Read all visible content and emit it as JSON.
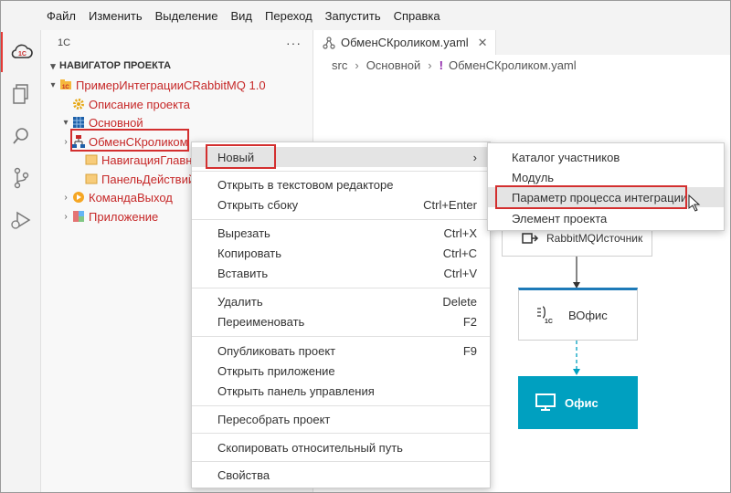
{
  "menubar": [
    "Файл",
    "Изменить",
    "Выделение",
    "Вид",
    "Переход",
    "Запустить",
    "Справка"
  ],
  "activity": [
    {
      "icon": "1c-cloud-icon",
      "active": true
    },
    {
      "icon": "files-icon",
      "active": false
    },
    {
      "icon": "search-icon",
      "active": false
    },
    {
      "icon": "source-control-icon",
      "active": false
    },
    {
      "icon": "run-debug-icon",
      "active": false
    }
  ],
  "sidebar": {
    "title": "1С",
    "more": "···",
    "section": "НАВИГАТОР ПРОЕКТА",
    "tree": [
      {
        "label": "ПримерИнтеграцииCRabbitMQ 1.0",
        "chevron": "▾",
        "icon": "project-icon",
        "depth": 0
      },
      {
        "label": "Описание проекта",
        "chevron": "",
        "icon": "gear-icon",
        "depth": 1
      },
      {
        "label": "Основной",
        "chevron": "▾",
        "icon": "grid-icon",
        "depth": 1
      },
      {
        "label": "ОбменСКроликом",
        "chevron": "›",
        "icon": "integration-icon",
        "depth": 2
      },
      {
        "label": "НавигацияГлавная",
        "chevron": "",
        "icon": "doc-icon",
        "depth": 2
      },
      {
        "label": "ПанельДействий",
        "chevron": "",
        "icon": "doc-icon",
        "depth": 2
      },
      {
        "label": "КомандаВыход",
        "chevron": "›",
        "icon": "play-icon",
        "depth": 2
      },
      {
        "label": "Приложение",
        "chevron": "›",
        "icon": "app-icon",
        "depth": 2
      }
    ]
  },
  "editor": {
    "tab": {
      "label": "ОбменСКроликом.yaml",
      "close": "✕"
    },
    "breadcrumbs": [
      "src",
      "Основной",
      "ОбменСКроликом.yaml"
    ],
    "breadcrumb_sep": "›",
    "breadcrumb_mark": "!"
  },
  "diagram": {
    "node1": "RabbitMQИсточник",
    "node2": "ВОфис",
    "node3": "Офис"
  },
  "context_menu": {
    "items": [
      {
        "label": "Новый",
        "shortcut": "›"
      },
      {
        "label": "Открыть в текстовом редакторе",
        "shortcut": ""
      },
      {
        "label": "Открыть сбоку",
        "shortcut": "Ctrl+Enter"
      },
      {
        "label": "Вырезать",
        "shortcut": "Ctrl+X"
      },
      {
        "label": "Копировать",
        "shortcut": "Ctrl+C"
      },
      {
        "label": "Вставить",
        "shortcut": "Ctrl+V"
      },
      {
        "label": "Удалить",
        "shortcut": "Delete"
      },
      {
        "label": "Переименовать",
        "shortcut": "F2"
      },
      {
        "label": "Опубликовать проект",
        "shortcut": "F9"
      },
      {
        "label": "Открыть приложение",
        "shortcut": ""
      },
      {
        "label": "Открыть панель управления",
        "shortcut": ""
      },
      {
        "label": "Пересобрать проект",
        "shortcut": ""
      },
      {
        "label": "Скопировать относительный путь",
        "shortcut": ""
      },
      {
        "label": "Свойства",
        "shortcut": ""
      }
    ]
  },
  "submenu": {
    "items": [
      "Каталог участников",
      "Модуль",
      "Параметр процесса интеграции",
      "Элемент проекта"
    ]
  },
  "colors": {
    "accent_red": "#d32f2f",
    "tree_red": "#c62828",
    "office_teal": "#00a0c0",
    "node_blue": "#1d7ab8"
  }
}
